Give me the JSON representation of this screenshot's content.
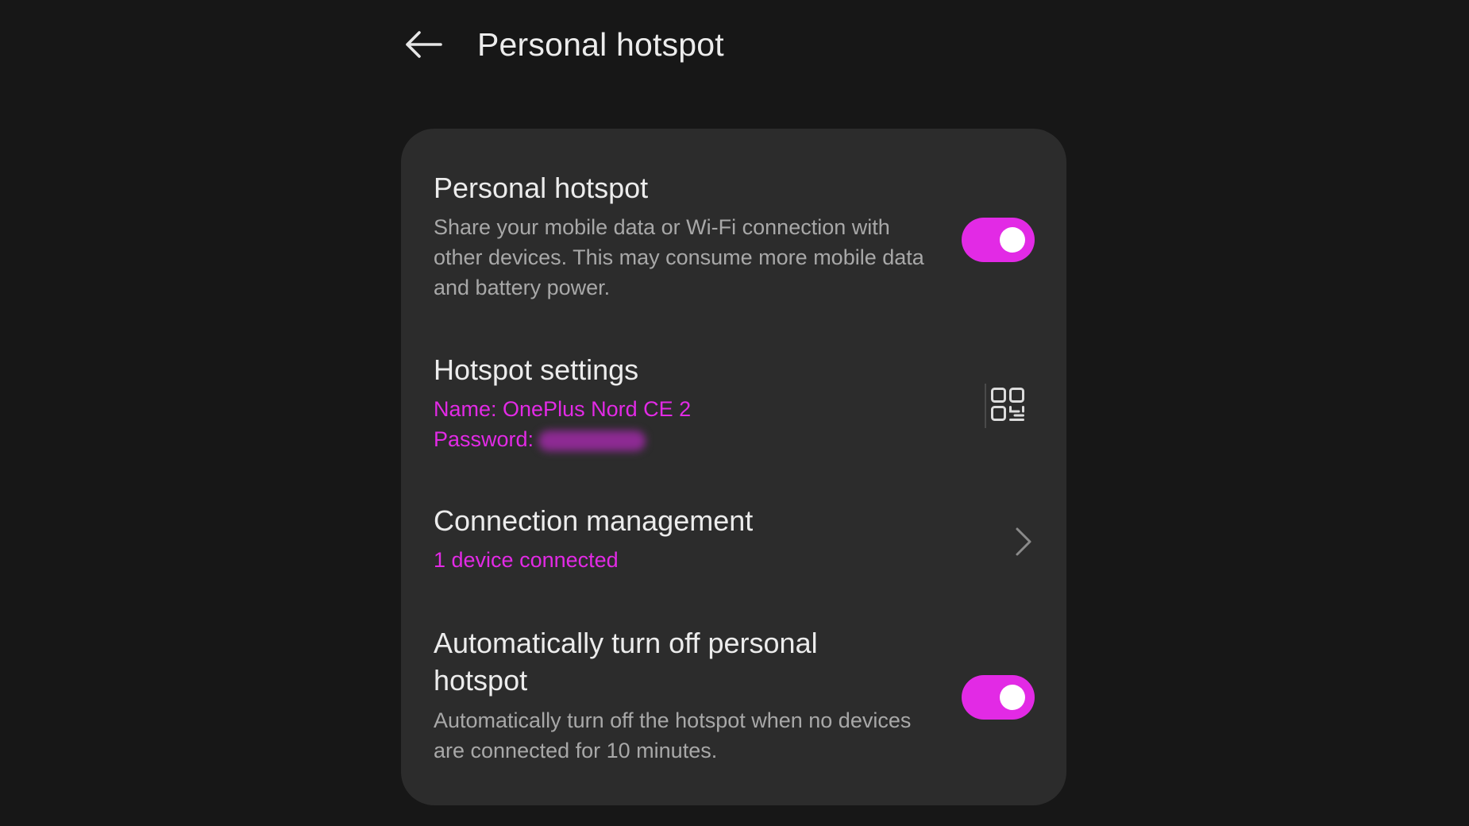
{
  "header": {
    "title": "Personal hotspot",
    "back_icon": "arrow-left-icon"
  },
  "colors": {
    "background": "#171717",
    "card": "#2c2c2c",
    "accent": "#e22ae5",
    "text_primary": "#ececec",
    "text_secondary": "#a8a8a8"
  },
  "rows": {
    "hotspot": {
      "title": "Personal hotspot",
      "description": "Share your mobile data or Wi-Fi connection with other devices. This may consume more mobile data and battery power.",
      "enabled": true
    },
    "settings": {
      "title": "Hotspot settings",
      "name_line": "Name: OnePlus Nord CE 2",
      "password_label": "Password:",
      "qr_icon": "qr-code-icon"
    },
    "connections": {
      "title": "Connection management",
      "status": "1 device connected",
      "chevron_icon": "chevron-right-icon"
    },
    "auto_off": {
      "title": "Automatically turn off personal hotspot",
      "description": "Automatically turn off the hotspot when no devices are connected for 10 minutes.",
      "enabled": true
    }
  }
}
